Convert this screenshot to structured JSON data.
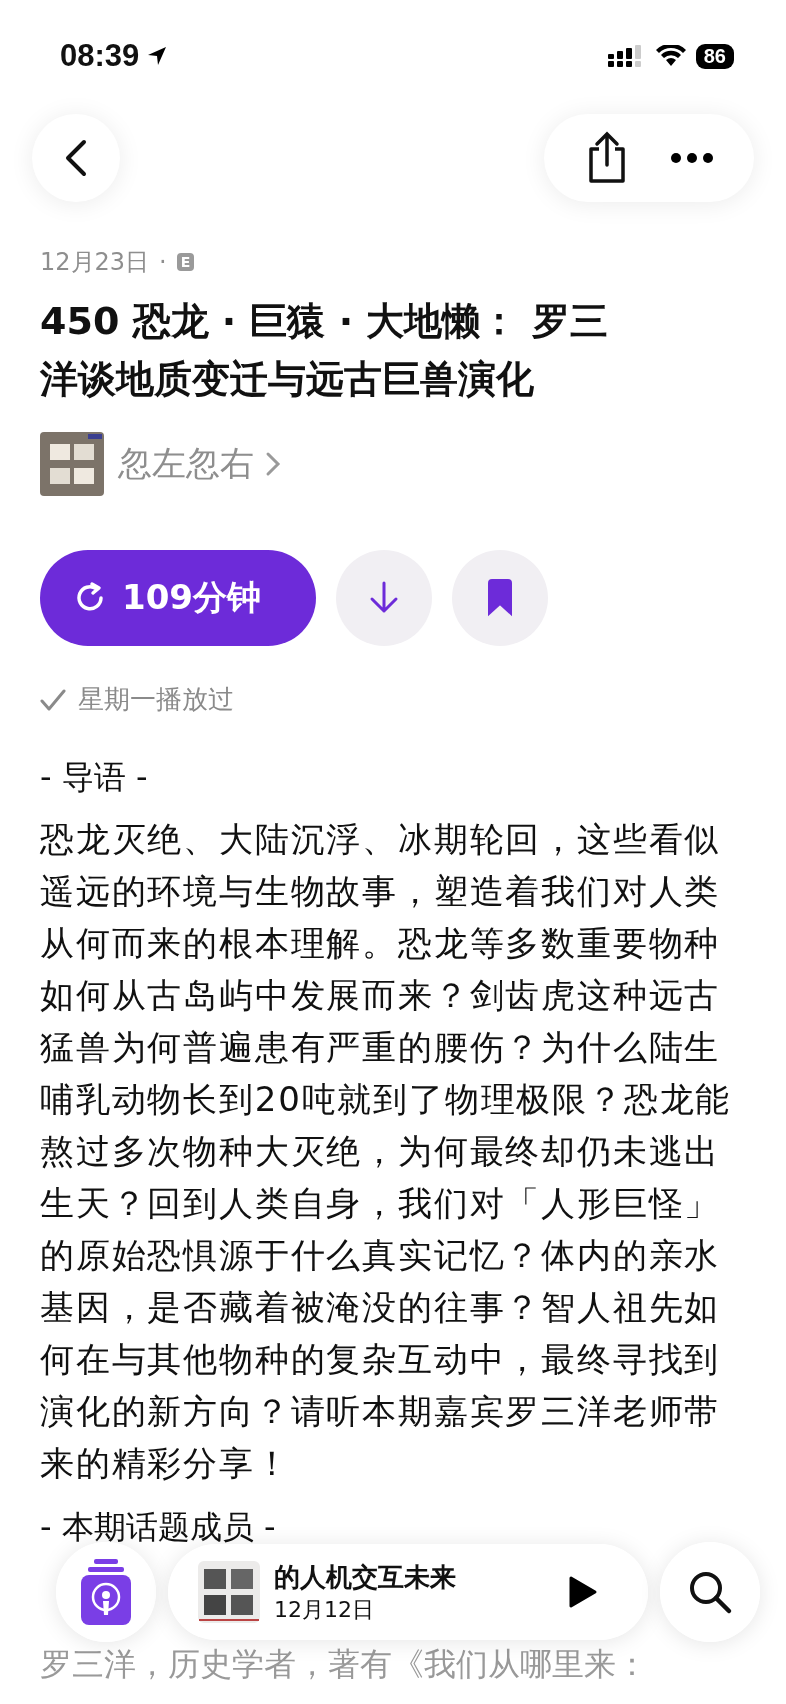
{
  "status_bar": {
    "time": "08:39",
    "battery": "86"
  },
  "episode": {
    "date": "12月23日",
    "separator": "·",
    "explicit_badge": "E",
    "title": "450 恐龙 · 巨猿 · 大地懒： 罗三洋谈地质变迁与远古巨兽演化",
    "podcast": "忽左忽右",
    "duration": "109分钟",
    "played": true,
    "played_label": "星期一播放过",
    "bookmarked": true
  },
  "notes": [
    {
      "kind": "heading",
      "text": "- 导语 -"
    },
    {
      "kind": "paragraph",
      "text": "恐龙灭绝、大陆沉浮、冰期轮回，这些看似遥远的环境与生物故事，塑造着我们对人类从何而来的根本理解。恐龙等多数重要物种如何从古岛屿中发展而来？剑齿虎这种远古猛兽为何普遍患有严重的腰伤？为什么陆生哺乳动物长到20吨就到了物理极限？恐龙能熬过多次物种大灭绝，为何最终却仍未逃出生天？回到人类自身，我们对「人形巨怪」的原始恐惧源于什么真实记忆？体内的亲水基因，是否藏着被淹没的往事？智人祖先如何在与其他物种的复杂互动中，最终寻找到演化的新方向？请听本期嘉宾罗三洋老师带来的精彩分享！"
    },
    {
      "kind": "heading",
      "text": "- 本期话题成员 -"
    },
    {
      "kind": "faded",
      "text": "罗三洋，历史学者，著有《我们从哪里来："
    }
  ],
  "mini_player": {
    "title": "的人机交互未来",
    "date": "12月12日"
  }
}
